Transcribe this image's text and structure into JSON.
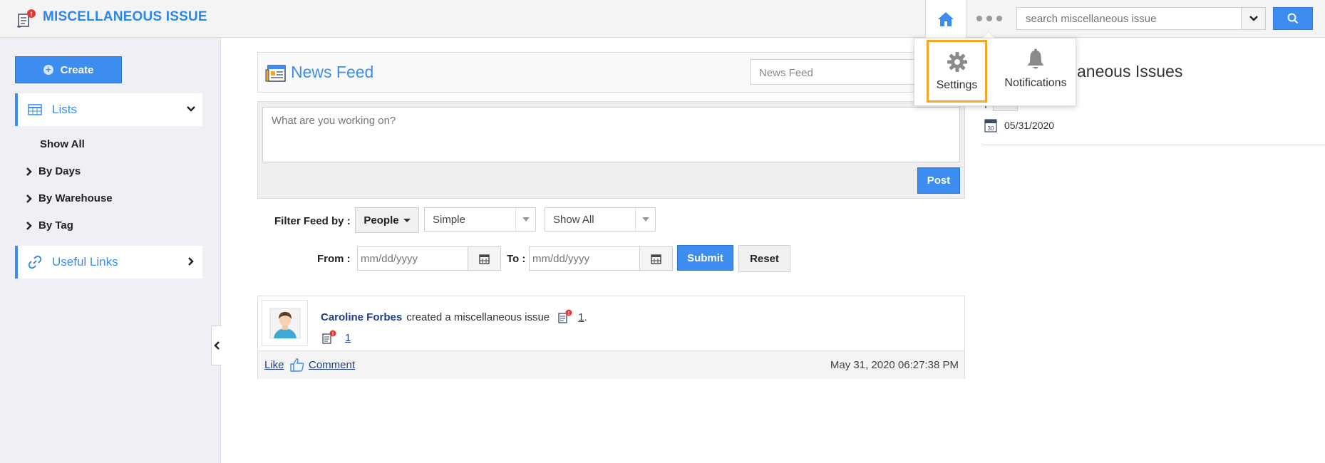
{
  "app": {
    "title": "MISCELLANEOUS ISSUE",
    "accent_color": "#3d8cf0",
    "brand_color": "#2b87e8"
  },
  "header": {
    "home_icon": "home-icon",
    "more_icon": "more-dots-icon",
    "search": {
      "placeholder": "search miscellaneous issue",
      "value": ""
    }
  },
  "dropdown_menu": {
    "items": [
      {
        "label": "Settings",
        "icon": "gear-icon",
        "highlighted": true
      },
      {
        "label": "Notifications",
        "icon": "bell-icon",
        "highlighted": false
      }
    ],
    "highlight_color": "#f5a623"
  },
  "sidebar": {
    "create_label": "Create",
    "lists_label": "Lists",
    "sub_items": [
      "Show All",
      "By Days",
      "By Warehouse",
      "By Tag"
    ],
    "useful_links_label": "Useful Links"
  },
  "news_feed": {
    "title": "News Feed",
    "select_value": "News Feed",
    "compose_placeholder": "What are you working on?",
    "post_label": "Post",
    "filter_label": "Filter Feed by :",
    "people_label": "People",
    "mode_value": "Simple",
    "scope_value": "Show All",
    "from_label": "From :",
    "to_label": "To :",
    "date_placeholder": "mm/dd/yyyy",
    "submit_label": "Submit",
    "reset_label": "Reset",
    "entry": {
      "user": "Caroline Forbes",
      "action": "created a miscellaneous issue",
      "link_text": "1",
      "link_suffix": ".",
      "second_link": "1",
      "like_label": "Like",
      "comment_label": "Comment",
      "timestamp": "May 31, 2020 06:27:38 PM"
    }
  },
  "right_panel": {
    "title_visible": "ellaneous Issues",
    "date": "05/31/2020",
    "calendar_day": "30"
  }
}
